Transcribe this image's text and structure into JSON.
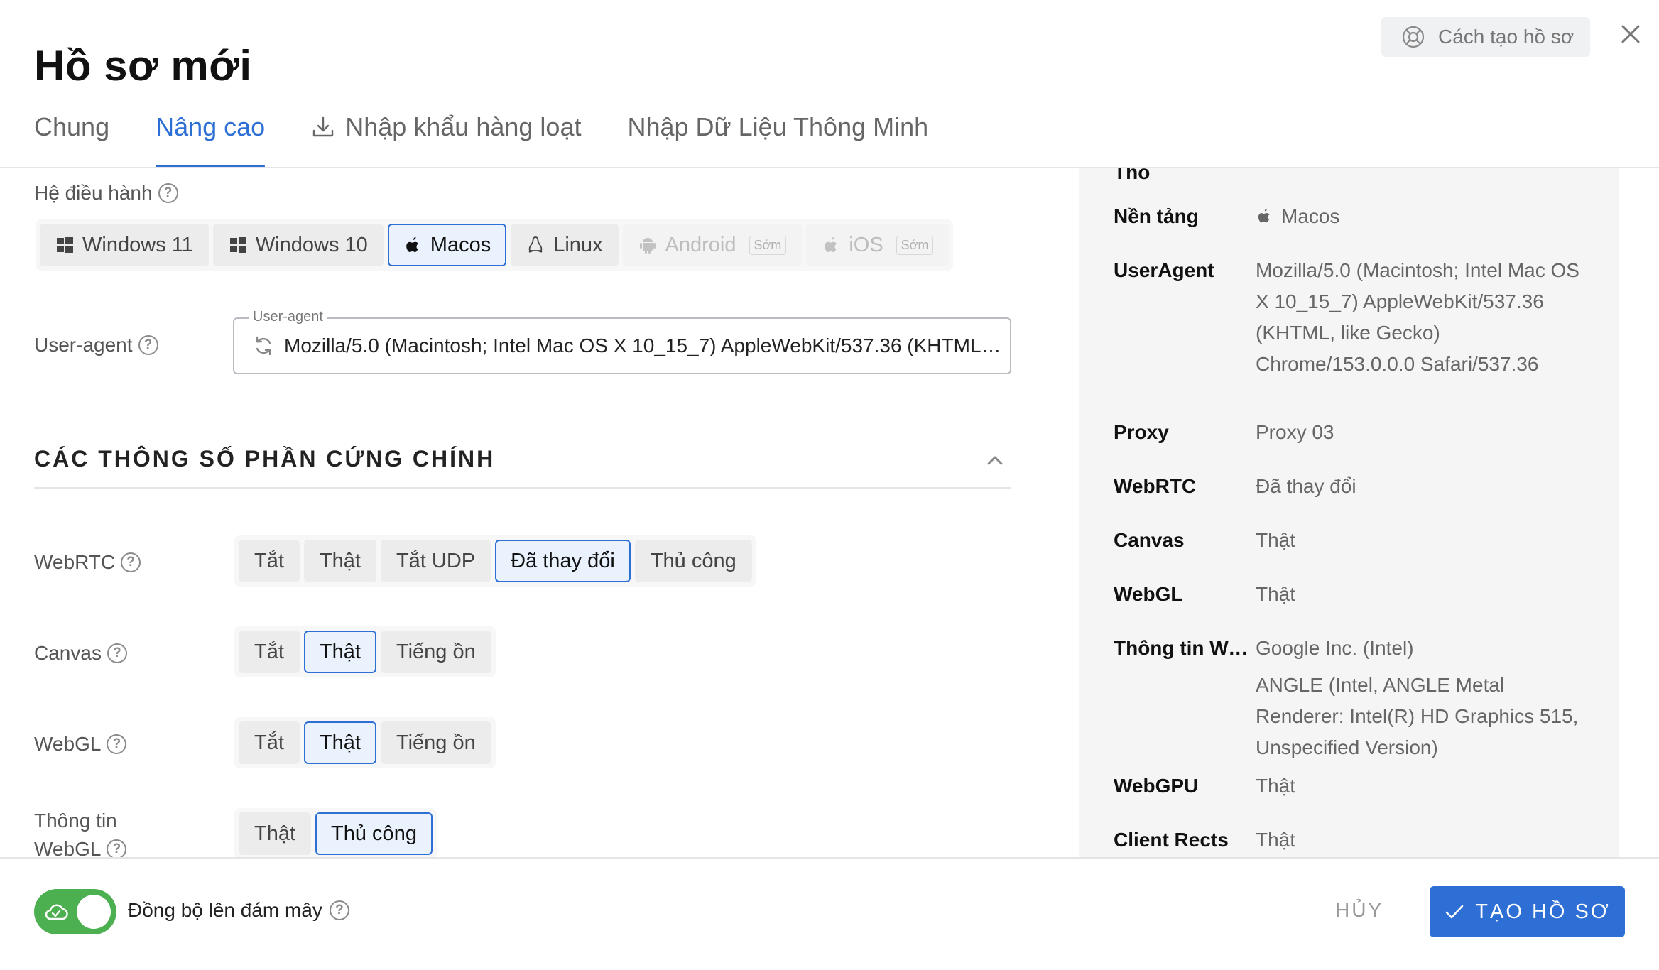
{
  "header": {
    "title": "Hồ sơ mới",
    "help_label": "Cách tạo hồ sơ",
    "tabs": [
      {
        "label": "Chung"
      },
      {
        "label": "Nâng cao"
      },
      {
        "label": "Nhập khẩu hàng loạt"
      },
      {
        "label": "Nhập Dữ Liệu Thông Minh"
      }
    ]
  },
  "os": {
    "label": "Hệ điều hành",
    "options": [
      {
        "label": "Windows 11",
        "icon": "windows-icon"
      },
      {
        "label": "Windows 10",
        "icon": "windows-icon"
      },
      {
        "label": "Macos",
        "icon": "apple-icon",
        "selected": true
      },
      {
        "label": "Linux",
        "icon": "linux-icon"
      },
      {
        "label": "Android",
        "icon": "android-icon",
        "badge": "Sớm",
        "disabled": true
      },
      {
        "label": "iOS",
        "icon": "apple-icon",
        "badge": "Sớm",
        "disabled": true
      }
    ]
  },
  "user_agent": {
    "label": "User-agent",
    "legend": "User-agent",
    "value": "Mozilla/5.0 (Macintosh; Intel Mac OS X 10_15_7) AppleWebKit/537.36 (KHTML, like Gecko) Chrome/153.0.0.0 Safari/537.36"
  },
  "hardware_section": {
    "title": "CÁC THÔNG SỐ PHẦN CỨNG CHÍNH"
  },
  "webrtc": {
    "label": "WebRTC",
    "options": [
      "Tắt",
      "Thật",
      "Tắt UDP",
      "Đã thay đổi",
      "Thủ công"
    ],
    "selected": "Đã thay đổi"
  },
  "canvas": {
    "label": "Canvas",
    "options": [
      "Tắt",
      "Thật",
      "Tiếng ồn"
    ],
    "selected": "Thật"
  },
  "webgl": {
    "label": "WebGL",
    "options": [
      "Tắt",
      "Thật",
      "Tiếng ồn"
    ],
    "selected": "Thật"
  },
  "webgl_info": {
    "label_line1": "Thông tin",
    "label_line2": "WebGL",
    "options": [
      "Thật",
      "Thủ công"
    ],
    "selected": "Thủ công"
  },
  "summary": {
    "rows": [
      {
        "key": "Nền tảng",
        "value": "Macos"
      },
      {
        "key": "UserAgent",
        "value": "Mozilla/5.0 (Macintosh; Intel Mac OS X 10_15_7) AppleWebKit/537.36 (KHTML, like Gecko) Chrome/153.0.0.0 Safari/537.36"
      },
      {
        "key": "Proxy",
        "value": "Proxy 03"
      },
      {
        "key": "WebRTC",
        "value": "Đã thay đổi"
      },
      {
        "key": "Canvas",
        "value": "Thật"
      },
      {
        "key": "WebGL",
        "value": "Thật"
      },
      {
        "key": "Thông tin WebGL",
        "value": "Google Inc. (Intel)",
        "value2": "ANGLE (Intel, ANGLE Metal Renderer: Intel(R) HD Graphics 515, Unspecified Version)"
      },
      {
        "key": "WebGPU",
        "value": "Thật"
      },
      {
        "key": "Client Rects",
        "value": "Thật"
      }
    ]
  },
  "footer": {
    "sync_label": "Đồng bộ lên đám mây",
    "sync_enabled": true,
    "cancel_label": "HỦY",
    "create_label": "TẠO HỒ SƠ"
  }
}
